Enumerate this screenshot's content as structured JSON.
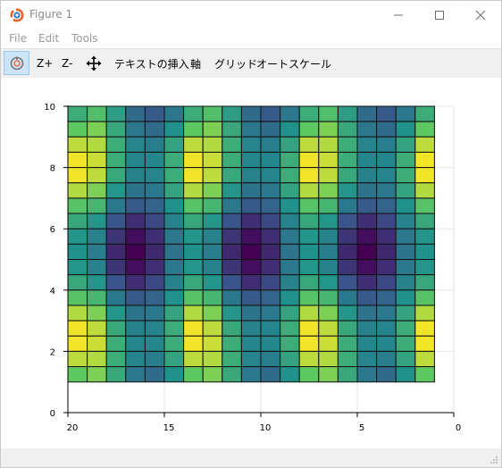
{
  "window": {
    "title": "Figure 1",
    "minimize_icon": "minimize-icon",
    "maximize_icon": "maximize-icon",
    "close_icon": "close-icon"
  },
  "menu": {
    "items": [
      "File",
      "Edit",
      "Tools"
    ]
  },
  "toolbar": {
    "home_icon": "home-reset-icon",
    "zoom_in_label": "Z+",
    "zoom_out_label": "Z-",
    "pan_icon": "pan-move-icon",
    "insert_text_label": "テキストの挿入",
    "axes_label": "軸",
    "grid_label": "グリッド",
    "autoscale_label": "オートスケール"
  },
  "colors": {
    "toolbar_bg": "#f0f0f0",
    "home_active_bg": "#cce4f7",
    "cell_border": "#111111",
    "grid_line": "#e6e6e6"
  },
  "chart_data": {
    "type": "heatmap",
    "colormap": "viridis",
    "grid": true,
    "x_axis": {
      "lim": [
        20,
        0
      ],
      "reversed": true,
      "ticks": [
        20,
        15,
        10,
        5,
        0
      ]
    },
    "y_axis": {
      "lim": [
        0,
        10
      ],
      "ticks": [
        0,
        2,
        4,
        6,
        8,
        10
      ]
    },
    "cells_x_range": [
      1,
      20
    ],
    "cells_y_range": [
      1,
      10
    ],
    "n_cols": 19,
    "n_rows": 18,
    "values": [
      [
        0.62,
        0.7,
        0.55,
        0.35,
        0.28,
        0.4,
        0.62,
        0.7,
        0.55,
        0.35,
        0.28,
        0.4,
        0.62,
        0.7,
        0.55,
        0.35,
        0.28,
        0.4,
        0.62
      ],
      [
        0.75,
        0.8,
        0.6,
        0.4,
        0.35,
        0.5,
        0.75,
        0.8,
        0.6,
        0.4,
        0.35,
        0.5,
        0.75,
        0.8,
        0.6,
        0.4,
        0.35,
        0.5,
        0.75
      ],
      [
        0.9,
        0.88,
        0.62,
        0.45,
        0.42,
        0.58,
        0.9,
        0.88,
        0.62,
        0.45,
        0.42,
        0.58,
        0.9,
        0.88,
        0.62,
        0.45,
        0.42,
        0.58,
        0.9
      ],
      [
        0.98,
        0.92,
        0.62,
        0.46,
        0.46,
        0.62,
        0.98,
        0.92,
        0.62,
        0.46,
        0.46,
        0.62,
        0.98,
        0.92,
        0.62,
        0.46,
        0.46,
        0.62,
        0.98
      ],
      [
        0.98,
        0.9,
        0.6,
        0.44,
        0.45,
        0.62,
        0.98,
        0.9,
        0.6,
        0.44,
        0.45,
        0.62,
        0.98,
        0.9,
        0.6,
        0.44,
        0.45,
        0.62,
        0.98
      ],
      [
        0.88,
        0.8,
        0.52,
        0.38,
        0.4,
        0.58,
        0.88,
        0.8,
        0.52,
        0.38,
        0.4,
        0.58,
        0.88,
        0.8,
        0.52,
        0.38,
        0.4,
        0.58,
        0.88
      ],
      [
        0.72,
        0.66,
        0.4,
        0.28,
        0.32,
        0.5,
        0.72,
        0.66,
        0.4,
        0.28,
        0.32,
        0.5,
        0.72,
        0.66,
        0.4,
        0.28,
        0.32,
        0.5,
        0.72
      ],
      [
        0.6,
        0.52,
        0.26,
        0.14,
        0.22,
        0.44,
        0.6,
        0.52,
        0.26,
        0.14,
        0.22,
        0.44,
        0.6,
        0.52,
        0.26,
        0.14,
        0.22,
        0.44,
        0.6
      ],
      [
        0.52,
        0.44,
        0.16,
        0.04,
        0.14,
        0.4,
        0.52,
        0.44,
        0.16,
        0.04,
        0.14,
        0.4,
        0.52,
        0.44,
        0.16,
        0.04,
        0.14,
        0.4,
        0.52
      ],
      [
        0.5,
        0.42,
        0.12,
        0.0,
        0.12,
        0.38,
        0.5,
        0.42,
        0.12,
        0.0,
        0.12,
        0.38,
        0.5,
        0.42,
        0.12,
        0.0,
        0.12,
        0.38,
        0.5
      ],
      [
        0.52,
        0.44,
        0.16,
        0.04,
        0.14,
        0.4,
        0.52,
        0.44,
        0.16,
        0.04,
        0.14,
        0.4,
        0.52,
        0.44,
        0.16,
        0.04,
        0.14,
        0.4,
        0.52
      ],
      [
        0.6,
        0.52,
        0.26,
        0.14,
        0.22,
        0.44,
        0.6,
        0.52,
        0.26,
        0.14,
        0.22,
        0.44,
        0.6,
        0.52,
        0.26,
        0.14,
        0.22,
        0.44,
        0.6
      ],
      [
        0.72,
        0.66,
        0.4,
        0.28,
        0.32,
        0.5,
        0.72,
        0.66,
        0.4,
        0.28,
        0.32,
        0.5,
        0.72,
        0.66,
        0.4,
        0.28,
        0.32,
        0.5,
        0.72
      ],
      [
        0.88,
        0.8,
        0.52,
        0.38,
        0.4,
        0.58,
        0.88,
        0.8,
        0.52,
        0.38,
        0.4,
        0.58,
        0.88,
        0.8,
        0.52,
        0.38,
        0.4,
        0.58,
        0.88
      ],
      [
        0.98,
        0.9,
        0.6,
        0.44,
        0.45,
        0.62,
        0.98,
        0.9,
        0.6,
        0.44,
        0.45,
        0.62,
        0.98,
        0.9,
        0.6,
        0.44,
        0.45,
        0.62,
        0.98
      ],
      [
        0.98,
        0.92,
        0.62,
        0.46,
        0.46,
        0.62,
        0.98,
        0.92,
        0.62,
        0.46,
        0.46,
        0.62,
        0.98,
        0.92,
        0.62,
        0.46,
        0.46,
        0.62,
        0.98
      ],
      [
        0.9,
        0.88,
        0.62,
        0.45,
        0.42,
        0.58,
        0.9,
        0.88,
        0.62,
        0.45,
        0.42,
        0.58,
        0.9,
        0.88,
        0.62,
        0.45,
        0.42,
        0.58,
        0.9
      ],
      [
        0.75,
        0.8,
        0.6,
        0.4,
        0.35,
        0.5,
        0.75,
        0.8,
        0.6,
        0.4,
        0.35,
        0.5,
        0.75,
        0.8,
        0.6,
        0.4,
        0.35,
        0.5,
        0.75
      ]
    ]
  }
}
